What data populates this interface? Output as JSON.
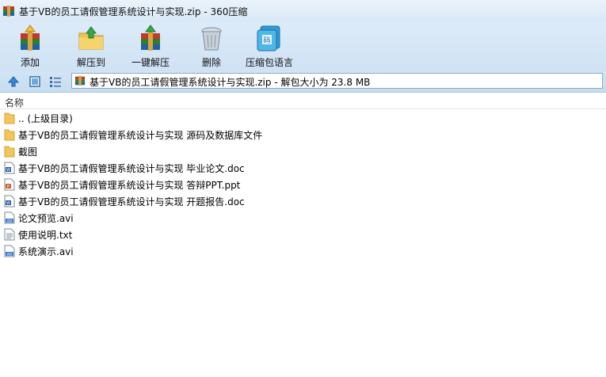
{
  "window": {
    "title": "基于VB的员工请假管理系统设计与实现.zip - 360压缩"
  },
  "toolbar": {
    "buttons": [
      {
        "label": "添加",
        "icon": "add-archive-icon"
      },
      {
        "label": "解压到",
        "icon": "extract-to-icon"
      },
      {
        "label": "一键解压",
        "icon": "one-click-extract-icon"
      },
      {
        "label": "删除",
        "icon": "delete-trash-icon"
      },
      {
        "label": "压缩包语言",
        "icon": "archive-language-icon"
      }
    ]
  },
  "addressbar": {
    "path": "基于VB的员工请假管理系统设计与实现.zip - 解包大小为 23.8 MB"
  },
  "list": {
    "column_name": "名称",
    "items": [
      {
        "name": ".. (上级目录)",
        "type": "folder"
      },
      {
        "name": "基于VB的员工请假管理系统设计与实现 源码及数据库文件",
        "type": "folder"
      },
      {
        "name": "截图",
        "type": "folder"
      },
      {
        "name": "基于VB的员工请假管理系统设计与实现 毕业论文.doc",
        "type": "doc"
      },
      {
        "name": "基于VB的员工请假管理系统设计与实现 答辩PPT.ppt",
        "type": "ppt"
      },
      {
        "name": "基于VB的员工请假管理系统设计与实现 开题报告.doc",
        "type": "doc"
      },
      {
        "name": "论文预览.avi",
        "type": "avi"
      },
      {
        "name": "使用说明.txt",
        "type": "txt"
      },
      {
        "name": "系统演示.avi",
        "type": "avi"
      }
    ]
  }
}
